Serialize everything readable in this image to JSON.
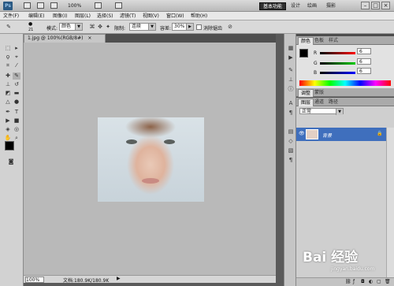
{
  "app": {
    "logo": "Ps",
    "zoom": "100%",
    "workspaces": [
      "基本功能",
      "设计",
      "绘画",
      "摄影"
    ],
    "window_controls": [
      "–",
      "□",
      "×"
    ]
  },
  "menu": [
    "文件(F)",
    "编辑(E)",
    "图像(I)",
    "图层(L)",
    "选择(S)",
    "滤镜(T)",
    "视图(V)",
    "窗口(W)",
    "帮助(H)"
  ],
  "options": {
    "brush_size": "21",
    "mode_label": "模式:",
    "mode_value": "颜色",
    "limit_label": "限制:",
    "limit_value": "连续",
    "tolerance_label": "容差:",
    "tolerance_value": "30%",
    "antialias_label": "消除锯齿"
  },
  "document": {
    "tab_title": "1.jpg @ 100%(RGB/8#)",
    "status_zoom": "100%",
    "status_doc": "文档:180.9K/180.9K"
  },
  "color_panel": {
    "tabs": [
      "颜色",
      "色板",
      "样式"
    ],
    "r_label": "R",
    "g_label": "G",
    "b_label": "B",
    "r_value": "6",
    "g_value": "6",
    "b_value": "6"
  },
  "adjust_panel": {
    "tabs": [
      "调整",
      "蒙版"
    ]
  },
  "layers_panel": {
    "tabs": [
      "图层",
      "通道",
      "路径"
    ],
    "blend_mode": "正常",
    "layer_name": "背景"
  },
  "watermark": {
    "text": "Bai 经验",
    "sub": "jingyan.baidu.com"
  },
  "colors": {
    "accent_layer": "#3f6fbd",
    "canvas_bg": "#b9b9b9"
  }
}
